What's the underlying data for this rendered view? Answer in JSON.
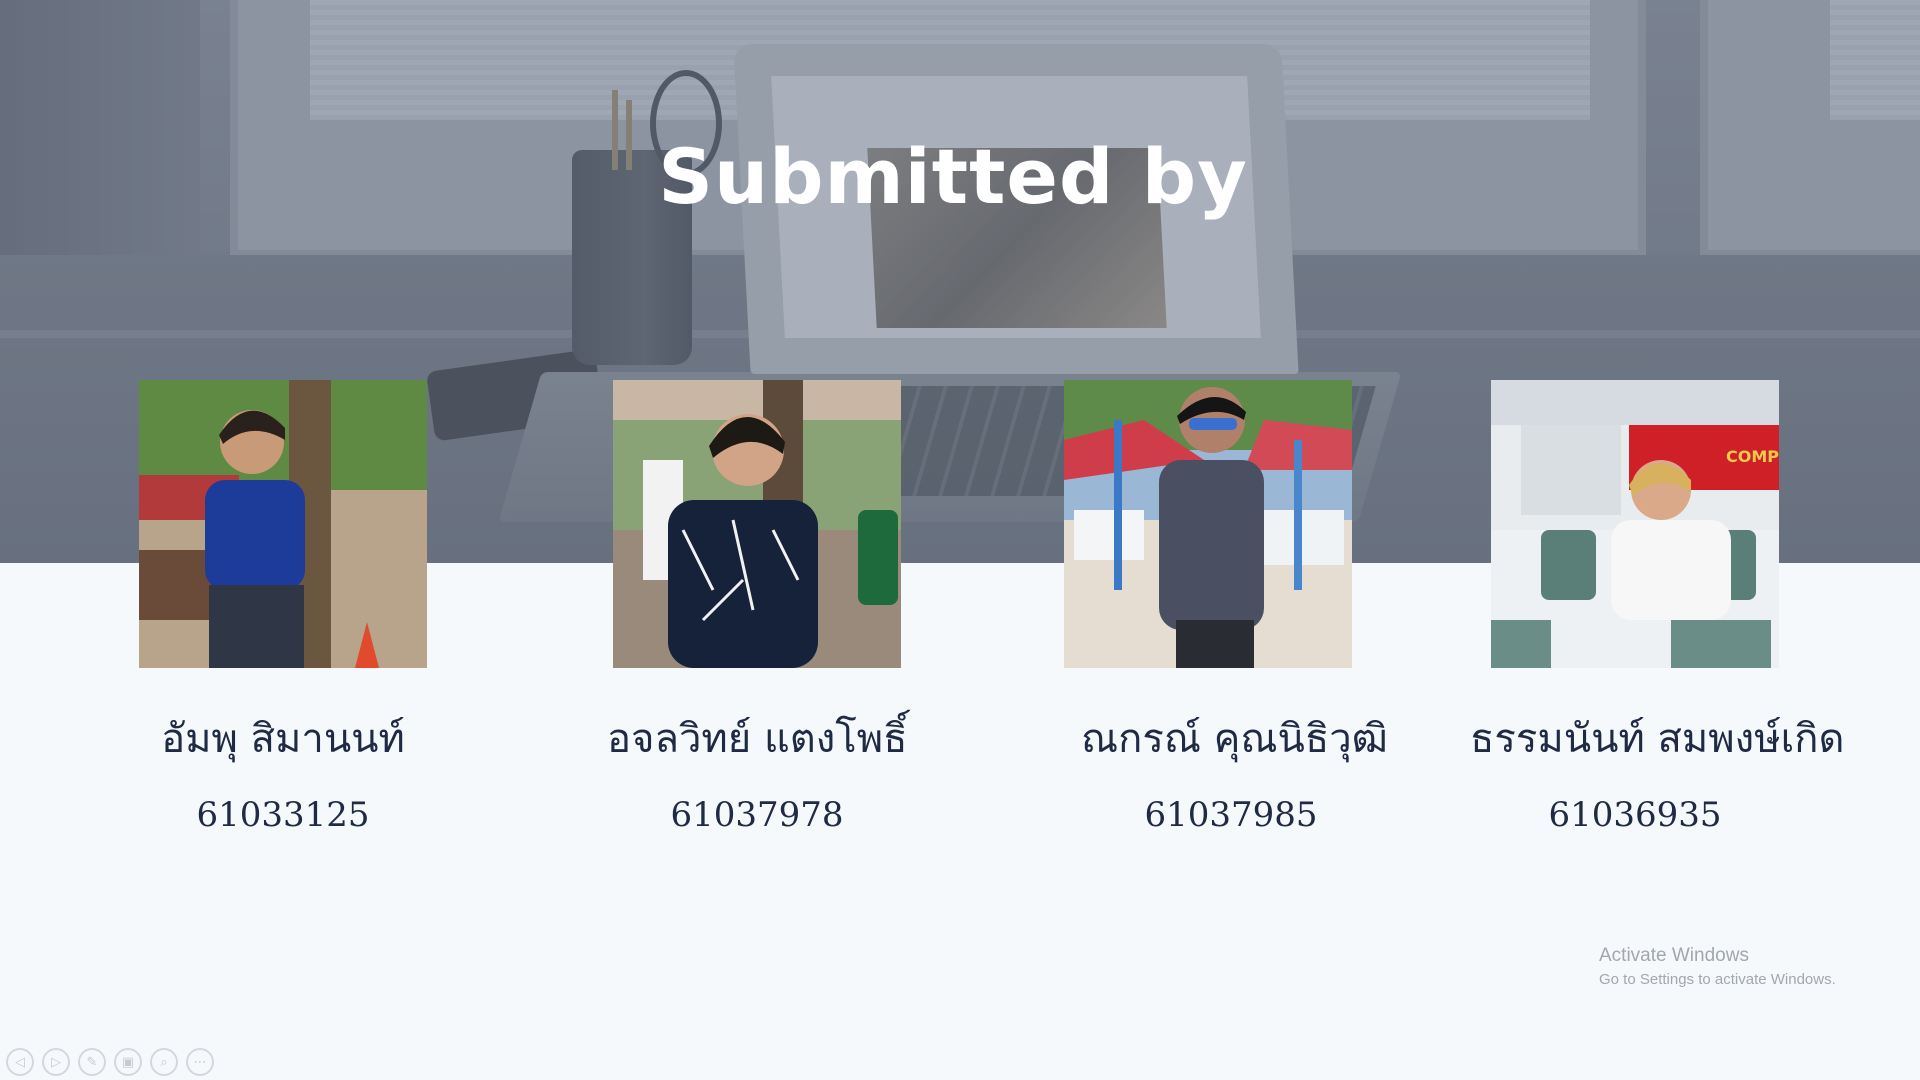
{
  "slide": {
    "title": "Submitted by"
  },
  "members": [
    {
      "name": "อัมพุ   สิมานนท์",
      "id": "61033125"
    },
    {
      "name": "อจลวิทย์ แตงโพธิ์",
      "id": "61037978"
    },
    {
      "name": "ณกรณ์ คุณนิธิวุฒิ",
      "id": "61037985"
    },
    {
      "name": "ธรรมนันท์ สมพงษ์เกิด",
      "id": "61036935"
    }
  ],
  "watermark": {
    "title": "Activate Windows",
    "subtitle": "Go to Settings to activate Windows."
  },
  "toolbar": {
    "buttons": [
      "previous-icon",
      "next-icon",
      "pen-icon",
      "slides-icon",
      "zoom-icon",
      "more-icon"
    ]
  },
  "colors": {
    "page_background": "#f6f9fc",
    "name_text": "#1f2a44",
    "title_text": "#ffffff"
  }
}
